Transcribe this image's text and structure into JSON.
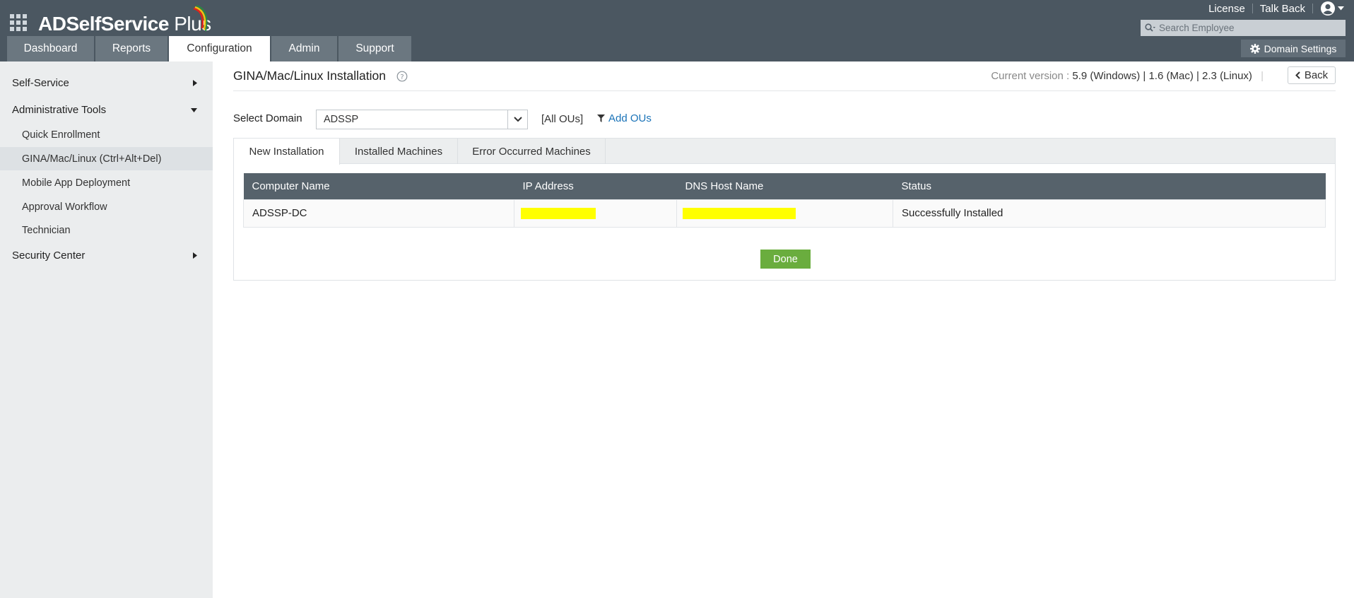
{
  "app": {
    "name_light": "ADSelfService",
    "name_bold": " Plus"
  },
  "header": {
    "links": [
      "License",
      "Talk Back"
    ],
    "search_placeholder": "Search Employee",
    "domain_settings_label": "Domain Settings",
    "tabs": [
      {
        "label": "Dashboard"
      },
      {
        "label": "Reports"
      },
      {
        "label": "Configuration",
        "active": true
      },
      {
        "label": "Admin"
      },
      {
        "label": "Support"
      }
    ]
  },
  "sidebar": {
    "sections": [
      {
        "label": "Self-Service"
      },
      {
        "label": "Administrative Tools"
      },
      {
        "label": "Security Center"
      }
    ],
    "items": [
      {
        "label": "Quick Enrollment"
      },
      {
        "label": "GINA/Mac/Linux (Ctrl+Alt+Del)",
        "active": true
      },
      {
        "label": "Mobile App Deployment"
      },
      {
        "label": "Approval Workflow"
      },
      {
        "label": "Technician"
      }
    ]
  },
  "main": {
    "title": "GINA/Mac/Linux Installation",
    "version_label": "Current version : ",
    "version_value": "5.9 (Windows) | 1.6 (Mac) | 2.3 (Linux)",
    "back_label": "Back",
    "domain_label": "Select Domain",
    "domain_value": "ADSSP",
    "all_ous": "[All OUs]",
    "add_ous": "Add OUs",
    "panel_tabs": [
      {
        "label": "New Installation",
        "active": true
      },
      {
        "label": "Installed Machines"
      },
      {
        "label": "Error Occurred Machines"
      }
    ],
    "table": {
      "headers": [
        "Computer Name",
        "IP Address",
        "DNS Host Name",
        "Status"
      ],
      "rows": [
        {
          "computer_name": "ADSSP-DC",
          "status": "Successfully Installed"
        }
      ]
    },
    "done_label": "Done"
  },
  "colors": {
    "header_bg": "#4b5761",
    "tab_bg": "#6b7780",
    "sidebar_bg": "#ebedee",
    "table_header_bg": "#56626b",
    "done_bg": "#6aad3e",
    "link": "#1a73b8",
    "redaction": "#ffff00"
  }
}
